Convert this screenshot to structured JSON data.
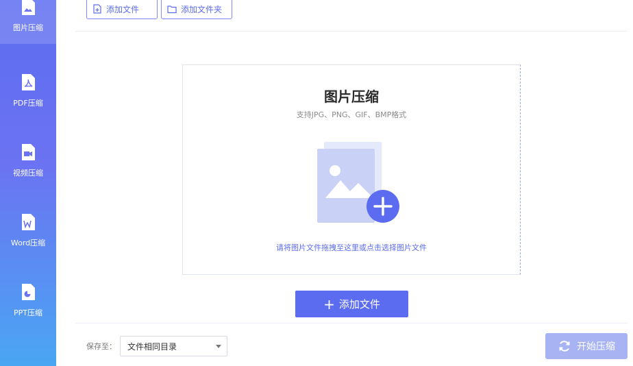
{
  "sidebar": {
    "items": [
      {
        "label": "图片压缩",
        "icon": "image-file-icon",
        "active": true
      },
      {
        "label": "PDF压缩",
        "icon": "pdf-file-icon",
        "active": false
      },
      {
        "label": "视频压缩",
        "icon": "video-file-icon",
        "active": false
      },
      {
        "label": "Word压缩",
        "icon": "word-file-icon",
        "active": false
      },
      {
        "label": "PPT压缩",
        "icon": "ppt-file-icon",
        "active": false
      }
    ]
  },
  "toolbar": {
    "add_file_label": "添加文件",
    "add_folder_label": "添加文件夹"
  },
  "drop_zone": {
    "title": "图片压缩",
    "subtitle": "支持JPG、PNG、GIF、BMP格式",
    "hint": "请将图片文件拖拽至这里或点击选择图片文件"
  },
  "add_button": {
    "label": "添加文件"
  },
  "footer": {
    "save_label": "保存至：",
    "save_value": "文件相同目录",
    "start_label": "开始压缩"
  },
  "colors": {
    "accent": "#5c6cf0",
    "sidebar_top": "#5c6cf0",
    "sidebar_bottom": "#4aa6f3",
    "start_disabled": "#a7b3f3"
  }
}
